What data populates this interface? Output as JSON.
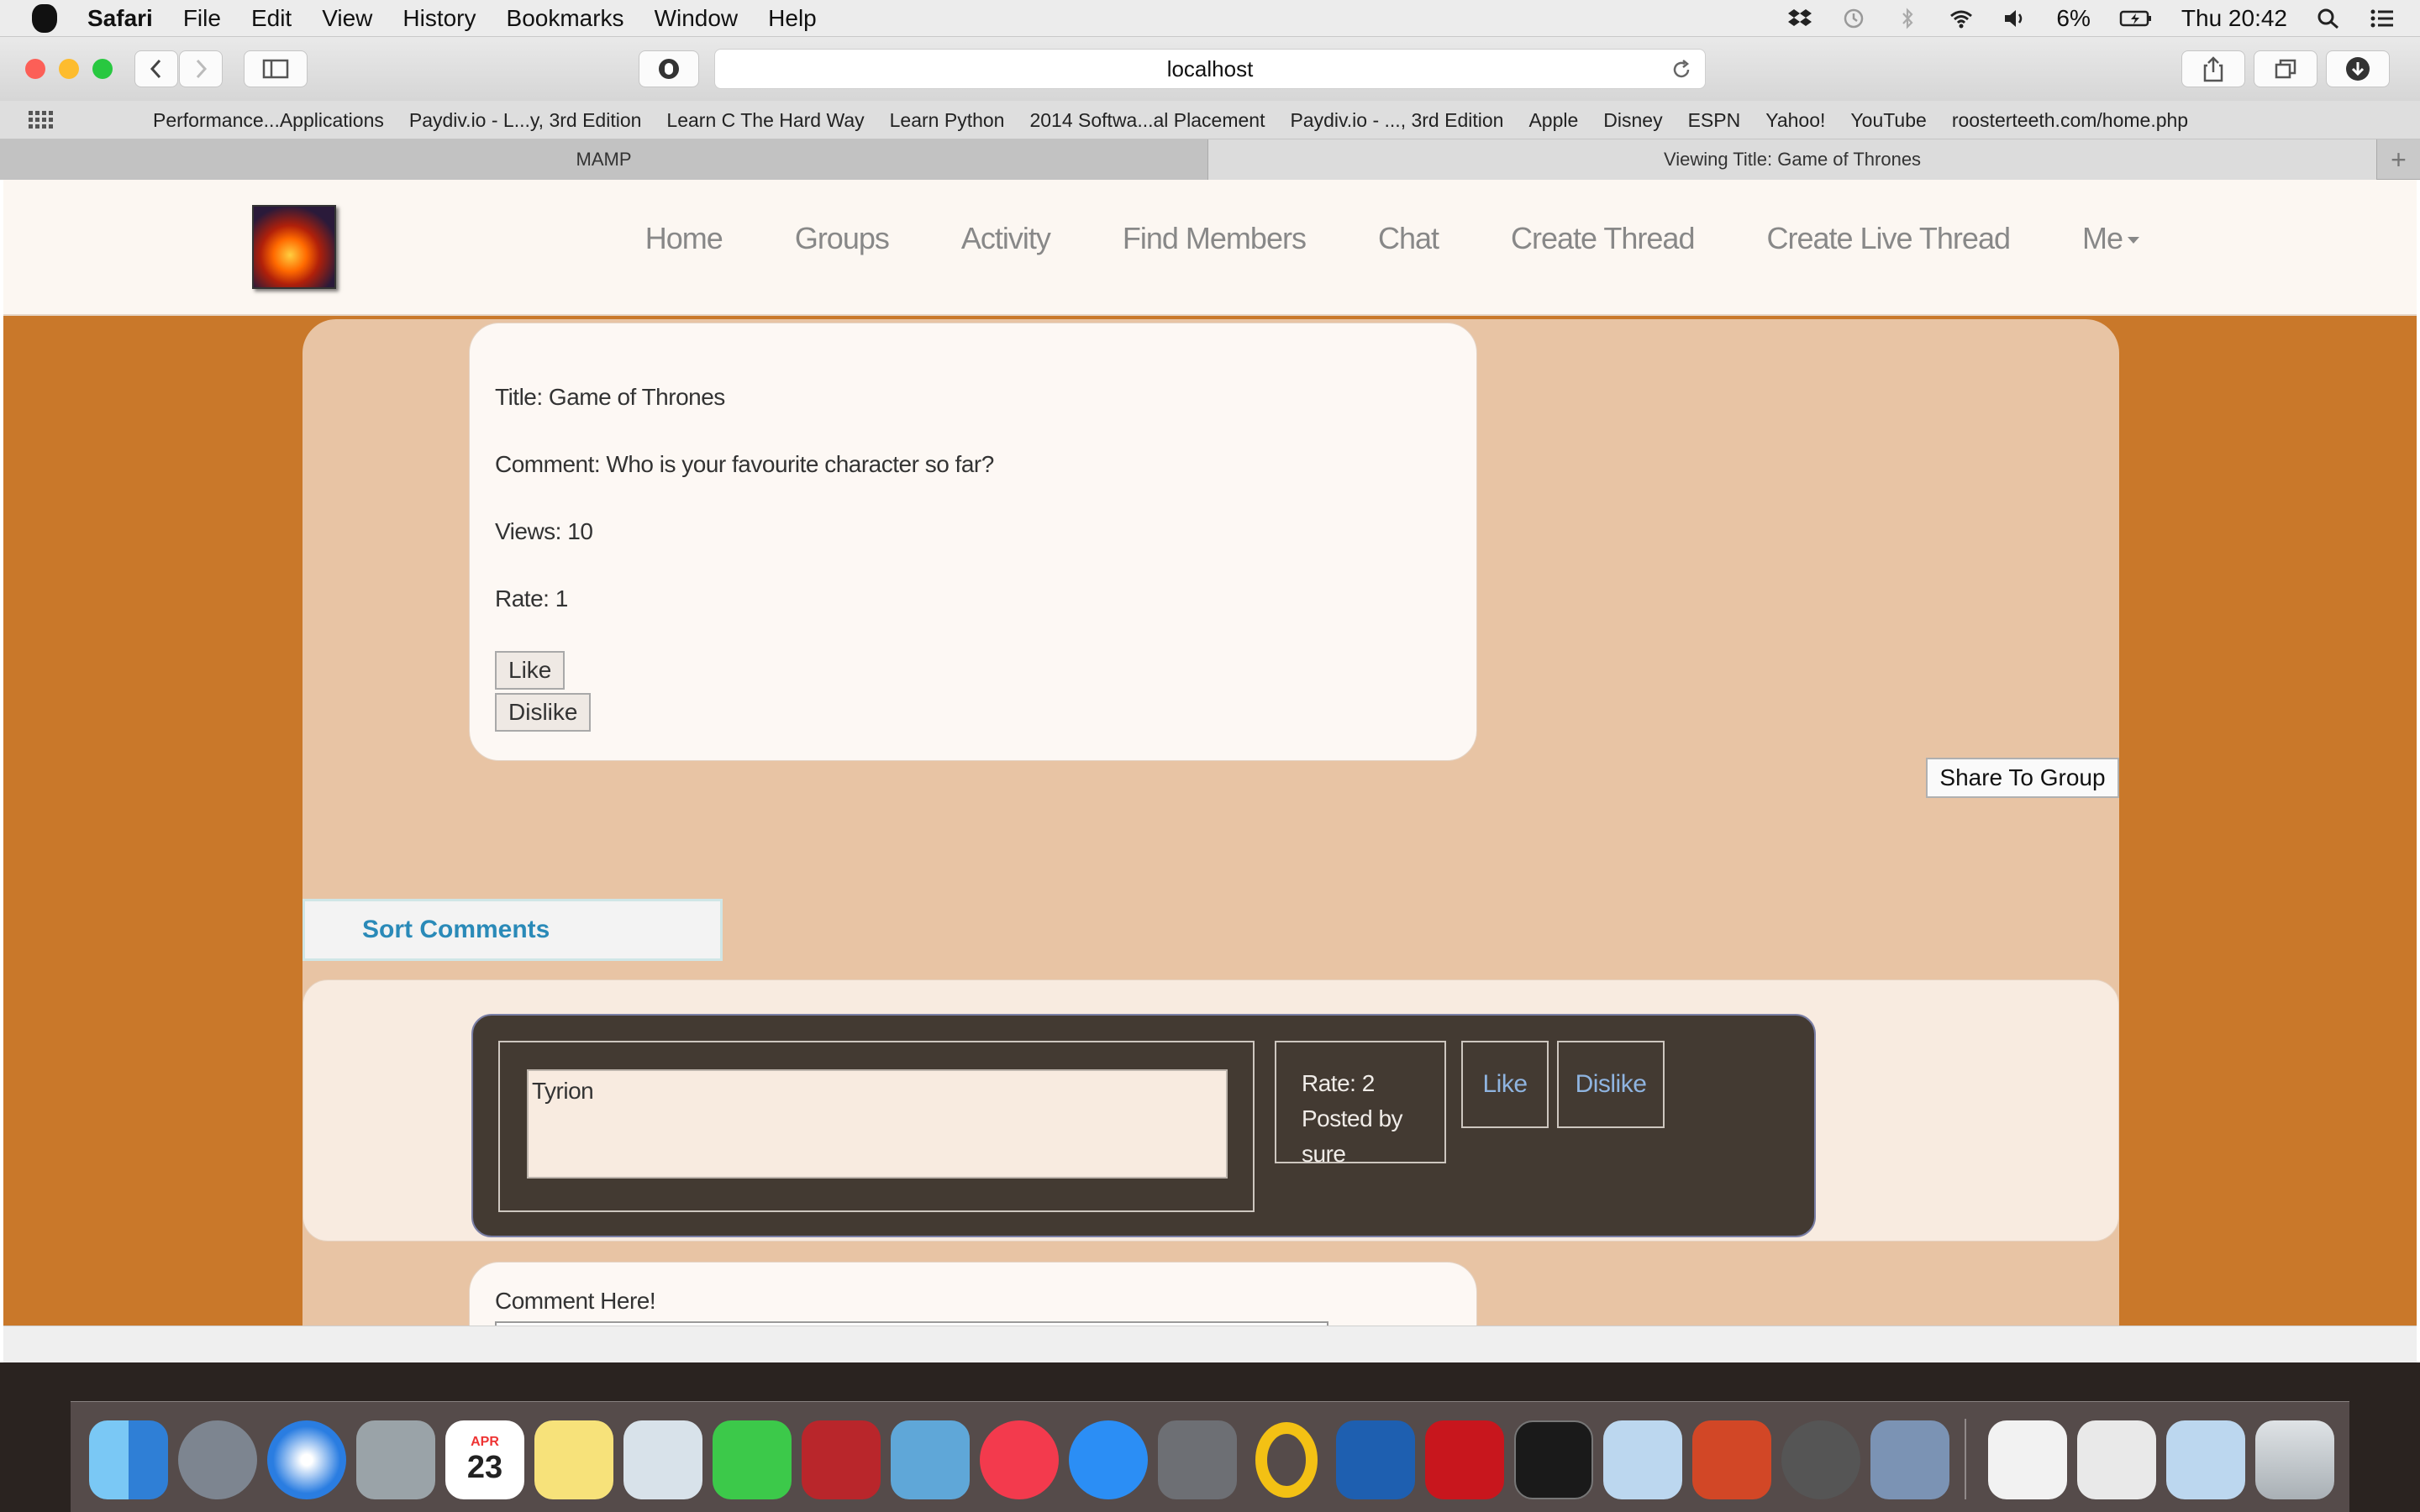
{
  "menubar": {
    "app": "Safari",
    "menus": [
      "File",
      "Edit",
      "View",
      "History",
      "Bookmarks",
      "Window",
      "Help"
    ],
    "battery": "6%",
    "clock": "Thu 20:42"
  },
  "browser": {
    "url": "localhost",
    "bookmarks": [
      "Performance...Applications",
      "Paydiv.io - L...y, 3rd Edition",
      "Learn C The Hard Way",
      "Learn Python",
      "2014 Softwa...al Placement",
      "Paydiv.io - ..., 3rd Edition",
      "Apple",
      "Disney",
      "ESPN",
      "Yahoo!",
      "YouTube",
      "roosterteeth.com/home.php"
    ],
    "tabs": [
      {
        "label": "MAMP",
        "active": false
      },
      {
        "label": "Viewing Title: Game of Thrones",
        "active": true
      }
    ],
    "new_tab": "+"
  },
  "site": {
    "nav": [
      "Home",
      "Groups",
      "Activity",
      "Find Members",
      "Chat",
      "Create Thread",
      "Create Live Thread",
      "Me"
    ],
    "thread": {
      "title": "Title: Game of Thrones",
      "comment": "Comment: Who is your favourite character so far?",
      "views": "Views: 10",
      "rate": "Rate: 1",
      "like": "Like",
      "dislike": "Dislike"
    },
    "share_button": "Share To Group",
    "sort_button": "Sort Comments",
    "comments": [
      {
        "text": "Tyrion",
        "rate": "Rate: 2",
        "posted_by": "Posted by sure",
        "like": "Like",
        "dislike": "Dislike"
      }
    ],
    "comment_form": {
      "label": "Comment Here!"
    }
  },
  "colors": {
    "page_bg": "#c9782a",
    "content_bg": "#e8c4a4",
    "card_bg": "#fdf8f4",
    "comment_bg": "#433a32",
    "link_blue": "#8fb4e0",
    "sort_blue": "#2a8ab8"
  },
  "dock": {
    "calendar_month": "APR",
    "calendar_day": "23"
  }
}
